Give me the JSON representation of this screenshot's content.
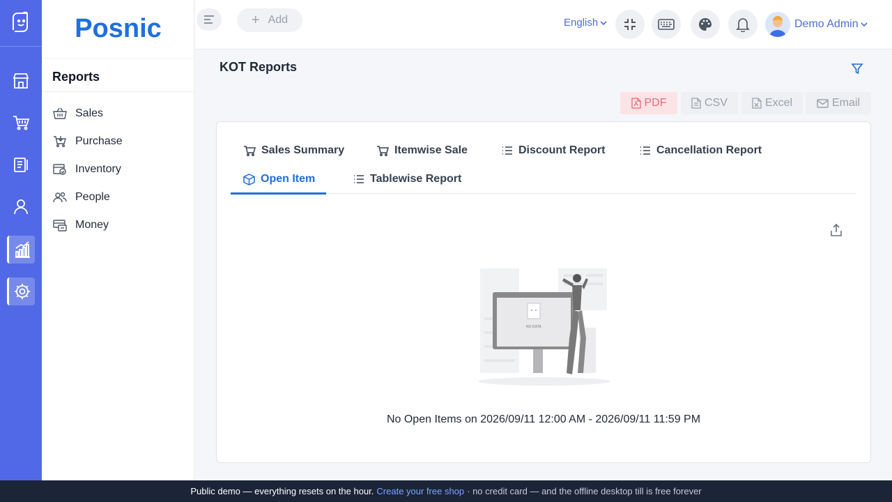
{
  "brand": {
    "name": "Posnic"
  },
  "sidebar": {
    "title": "Reports",
    "items": [
      {
        "label": "Sales",
        "icon": "basket-icon"
      },
      {
        "label": "Purchase",
        "icon": "cart-icon"
      },
      {
        "label": "Inventory",
        "icon": "boxes-icon"
      },
      {
        "label": "People",
        "icon": "people-icon"
      },
      {
        "label": "Money",
        "icon": "money-icon"
      }
    ]
  },
  "rail": {
    "items": [
      {
        "icon": "store-icon"
      },
      {
        "icon": "cart-icon"
      },
      {
        "icon": "clipboard-icon"
      },
      {
        "icon": "user-icon"
      },
      {
        "icon": "chart-icon",
        "active": true
      },
      {
        "icon": "gear-icon",
        "active": true
      }
    ]
  },
  "topbar": {
    "add_label": "Add",
    "language": "English",
    "user_name": "Demo Admin"
  },
  "page": {
    "title": "KOT Reports",
    "export": {
      "pdf": "PDF",
      "csv": "CSV",
      "excel": "Excel",
      "email": "Email"
    }
  },
  "tabs": [
    {
      "label": "Sales Summary",
      "icon": "cart-icon"
    },
    {
      "label": "Itemwise Sale",
      "icon": "cart-icon"
    },
    {
      "label": "Discount Report",
      "icon": "list-icon"
    },
    {
      "label": "Cancellation Report",
      "icon": "list-icon"
    },
    {
      "label": "Open Item",
      "icon": "box-icon",
      "active": true
    },
    {
      "label": "Tablewise Report",
      "icon": "list-icon"
    }
  ],
  "empty": {
    "illustration_text": "NO DATA",
    "message": "No Open Items on 2026/09/11 12:00 AM - 2026/09/11 11:59 PM"
  },
  "footer": {
    "lead": "Public demo — everything resets on the hour.",
    "link": "Create your free shop",
    "tail": "· no credit card — and the offline desktop till is free forever"
  },
  "colors": {
    "accent": "#1f6fe0",
    "rail": "#5169e6",
    "footer": "#1c2437"
  }
}
